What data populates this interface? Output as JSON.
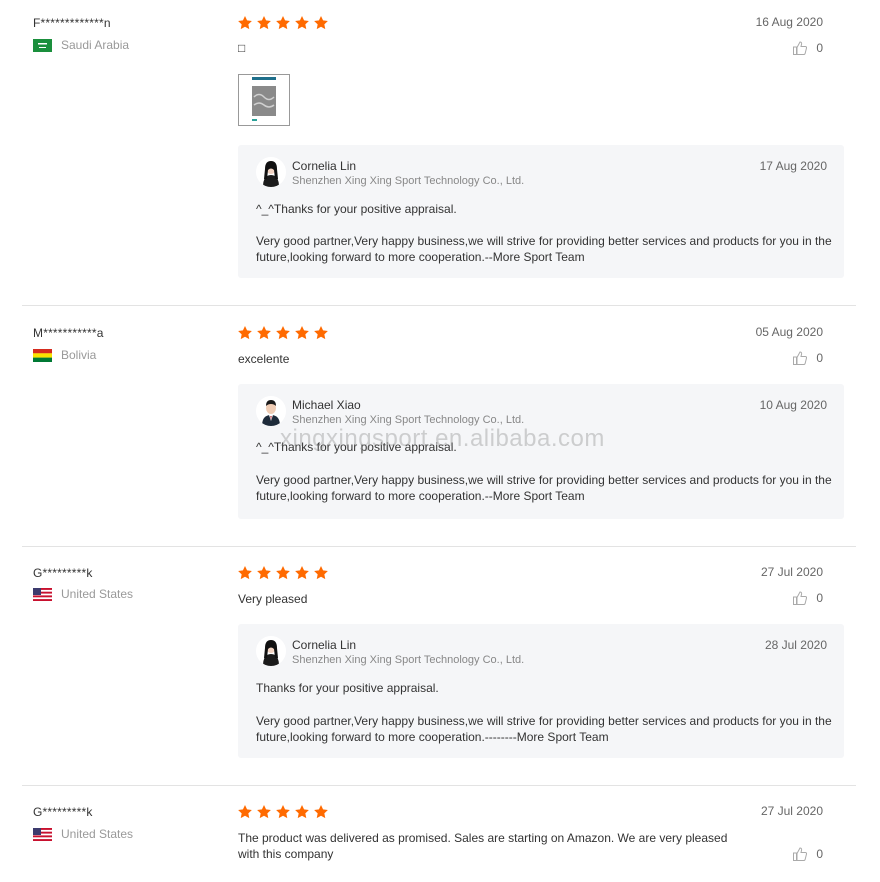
{
  "watermark": "xingxingsport.en.alibaba.com",
  "reviews": [
    {
      "reviewer": "F*************n",
      "country": "Saudi Arabia",
      "date": "16 Aug 2020",
      "likes": "0",
      "text": "□",
      "rating": 5,
      "reply": {
        "name": "Cornelia Lin",
        "company": "Shenzhen Xing Xing Sport Technology Co., Ltd.",
        "date": "17 Aug 2020",
        "line1": "^_^Thanks for your positive appraisal.",
        "line2": "Very good partner,Very happy business,we will strive for providing better services and products for you in the future,looking forward to more cooperation.--More Sport Team"
      }
    },
    {
      "reviewer": "M***********a",
      "country": "Bolivia",
      "date": "05 Aug 2020",
      "likes": "0",
      "text": "excelente",
      "rating": 5,
      "reply": {
        "name": "Michael Xiao",
        "company": "Shenzhen Xing Xing Sport Technology Co., Ltd.",
        "date": "10 Aug 2020",
        "line1": "^_^Thanks for your positive appraisal.",
        "line2": "Very good partner,Very happy business,we will strive for providing better services and products for you in the future,looking forward to more cooperation.--More Sport Team"
      }
    },
    {
      "reviewer": "G*********k",
      "country": "United States",
      "date": "27 Jul 2020",
      "likes": "0",
      "text": "Very pleased",
      "rating": 5,
      "reply": {
        "name": "Cornelia Lin",
        "company": "Shenzhen Xing Xing Sport Technology Co., Ltd.",
        "date": "28 Jul 2020",
        "line1": "Thanks for your positive appraisal.",
        "line2": "Very good partner,Very happy business,we will strive for providing better services and products for you in the future,looking forward to more cooperation.--------More Sport Team"
      }
    },
    {
      "reviewer": "G*********k",
      "country": "United States",
      "date": "27 Jul 2020",
      "likes": "0",
      "text": "The product was delivered as promised. Sales are starting on Amazon. We are very pleased with this company",
      "rating": 5
    }
  ],
  "colors": {
    "star": "#ff6a00",
    "reply_bg": "#f5f6f8",
    "separator": "#e3e3e3"
  }
}
